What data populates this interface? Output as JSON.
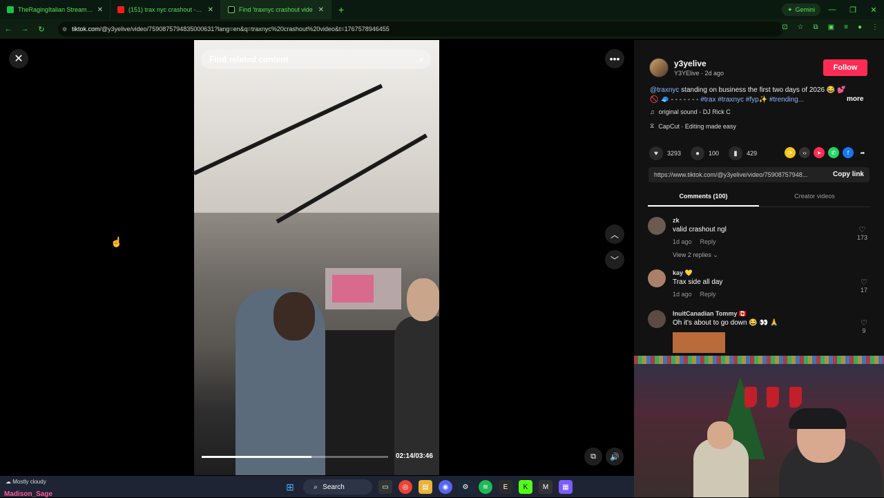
{
  "browser": {
    "tabs": [
      {
        "title": "TheRagingItalian Stream - Wat",
        "color": "#1dbf4a"
      },
      {
        "title": "(151) trax nyc crashout - YouTu",
        "color": "#ff1a1a"
      },
      {
        "title": "Find 'traxnyc crashout vide",
        "color": "#000000"
      }
    ],
    "new_tab": "+",
    "gemini": "Gemini",
    "url_site": "tiktok.com",
    "url_path": "/@y3yelive/video/7590875794835000631?lang=en&q=traxnyc%20crashout%20video&t=1767578946455"
  },
  "video": {
    "search_placeholder": "Find related content",
    "time": "02:14/03:46",
    "progress": 0.59
  },
  "panel": {
    "username": "y3yelive",
    "subline": "Y3YElive · 2d ago",
    "follow": "Follow",
    "description": {
      "mention": "@traxnyc",
      "text": " standing on business the first two days of 2026 😂 💕",
      "line2_prefix": "🚫 🧢 - - - - - - - ",
      "tags": "#trax #traxnyc #fyp✨ #trending..."
    },
    "more": "more",
    "sound": "original sound - DJ Rick C",
    "capcut": "CapCut · Editing made easy",
    "likes": "3293",
    "comments_count": "100",
    "saves": "429",
    "share_link": "https://www.tiktok.com/@y3yelive/video/75908757948...",
    "copy_link": "Copy link",
    "tab_comments": "Comments (100)",
    "tab_creator": "Creator videos",
    "comments": [
      {
        "name": "zk",
        "text": "valid crashout ngl",
        "time": "1d ago",
        "reply": "Reply",
        "likes": "173",
        "replies": "View 2 replies ⌄"
      },
      {
        "name": "kay 💛",
        "text": "Trax side all day",
        "time": "1d ago",
        "reply": "Reply",
        "likes": "17"
      },
      {
        "name": "InuitCanadian Tommy 🇨🇦",
        "text": "Oh it's about to go down 😂 👀 🙏",
        "likes": "9"
      }
    ]
  },
  "taskbar": {
    "search": "Search",
    "weather": "Mostly cloudy",
    "stream_name": "Madison_Sage"
  }
}
